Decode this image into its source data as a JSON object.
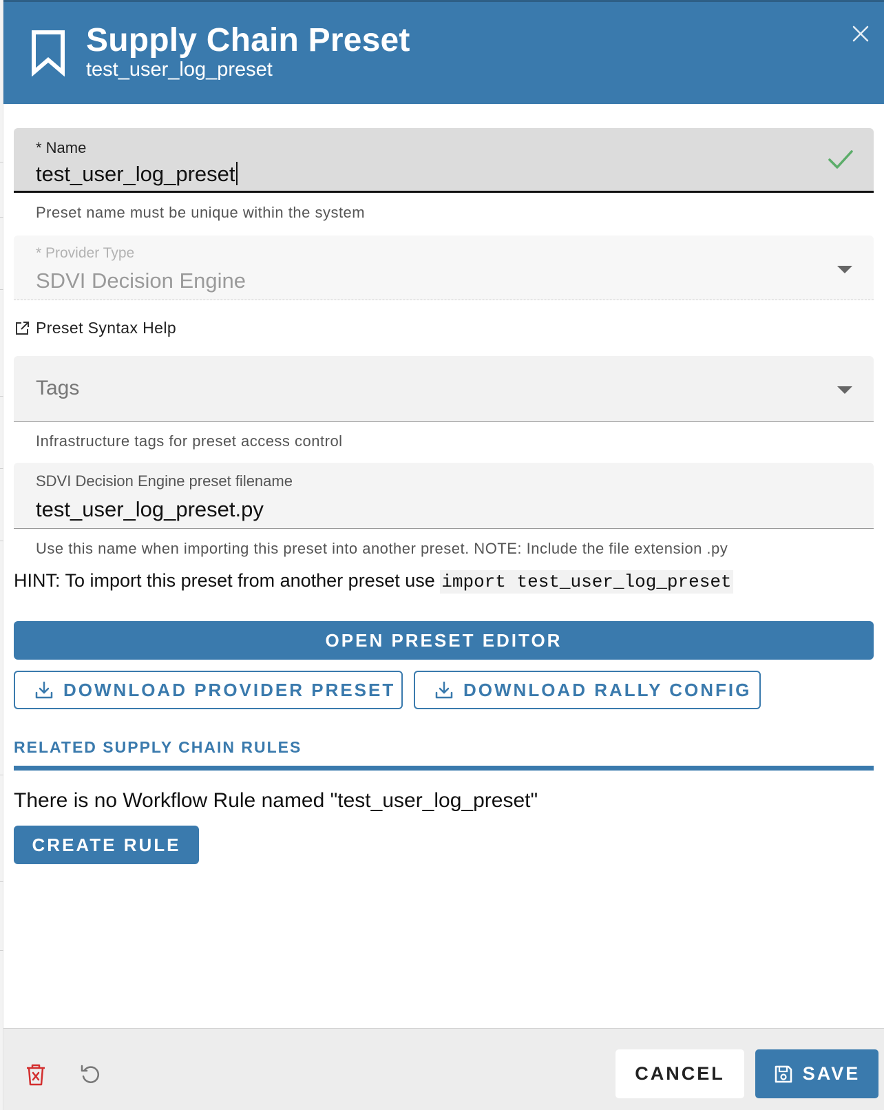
{
  "header": {
    "title": "Supply Chain Preset",
    "subtitle": "test_user_log_preset"
  },
  "form": {
    "name": {
      "label": "* Name",
      "value": "test_user_log_preset",
      "helper": "Preset name must be unique within the system",
      "valid": true
    },
    "provider_type": {
      "label": "* Provider Type",
      "value": "SDVI Decision Engine",
      "disabled": true
    },
    "syntax_help_link": "Preset Syntax Help",
    "tags": {
      "placeholder": "Tags",
      "helper": "Infrastructure tags for preset access control"
    },
    "filename": {
      "label": "SDVI Decision Engine preset filename",
      "value": "test_user_log_preset.py",
      "helper": "Use this name when importing this preset into another preset. NOTE: Include the file extension .py"
    },
    "hint": {
      "text": "HINT: To import this preset from another preset use ",
      "code": "import test_user_log_preset"
    }
  },
  "actions": {
    "open_editor": "OPEN PRESET EDITOR",
    "download_provider": "DOWNLOAD PROVIDER PRESET",
    "download_rally": "DOWNLOAD RALLY CONFIG"
  },
  "related": {
    "title": "RELATED SUPPLY CHAIN RULES",
    "empty_message": "There is no Workflow Rule named \"test_user_log_preset\"",
    "create_button": "CREATE RULE"
  },
  "footer": {
    "cancel": "CANCEL",
    "save": "SAVE"
  },
  "colors": {
    "primary": "#3a7aad",
    "valid_check": "#5cad6a",
    "delete": "#d32f2f"
  },
  "icons": [
    "bookmark-icon",
    "close-icon",
    "check-icon",
    "chevron-down-icon",
    "external-link-icon",
    "download-icon",
    "trash-icon",
    "undo-icon",
    "save-icon"
  ]
}
